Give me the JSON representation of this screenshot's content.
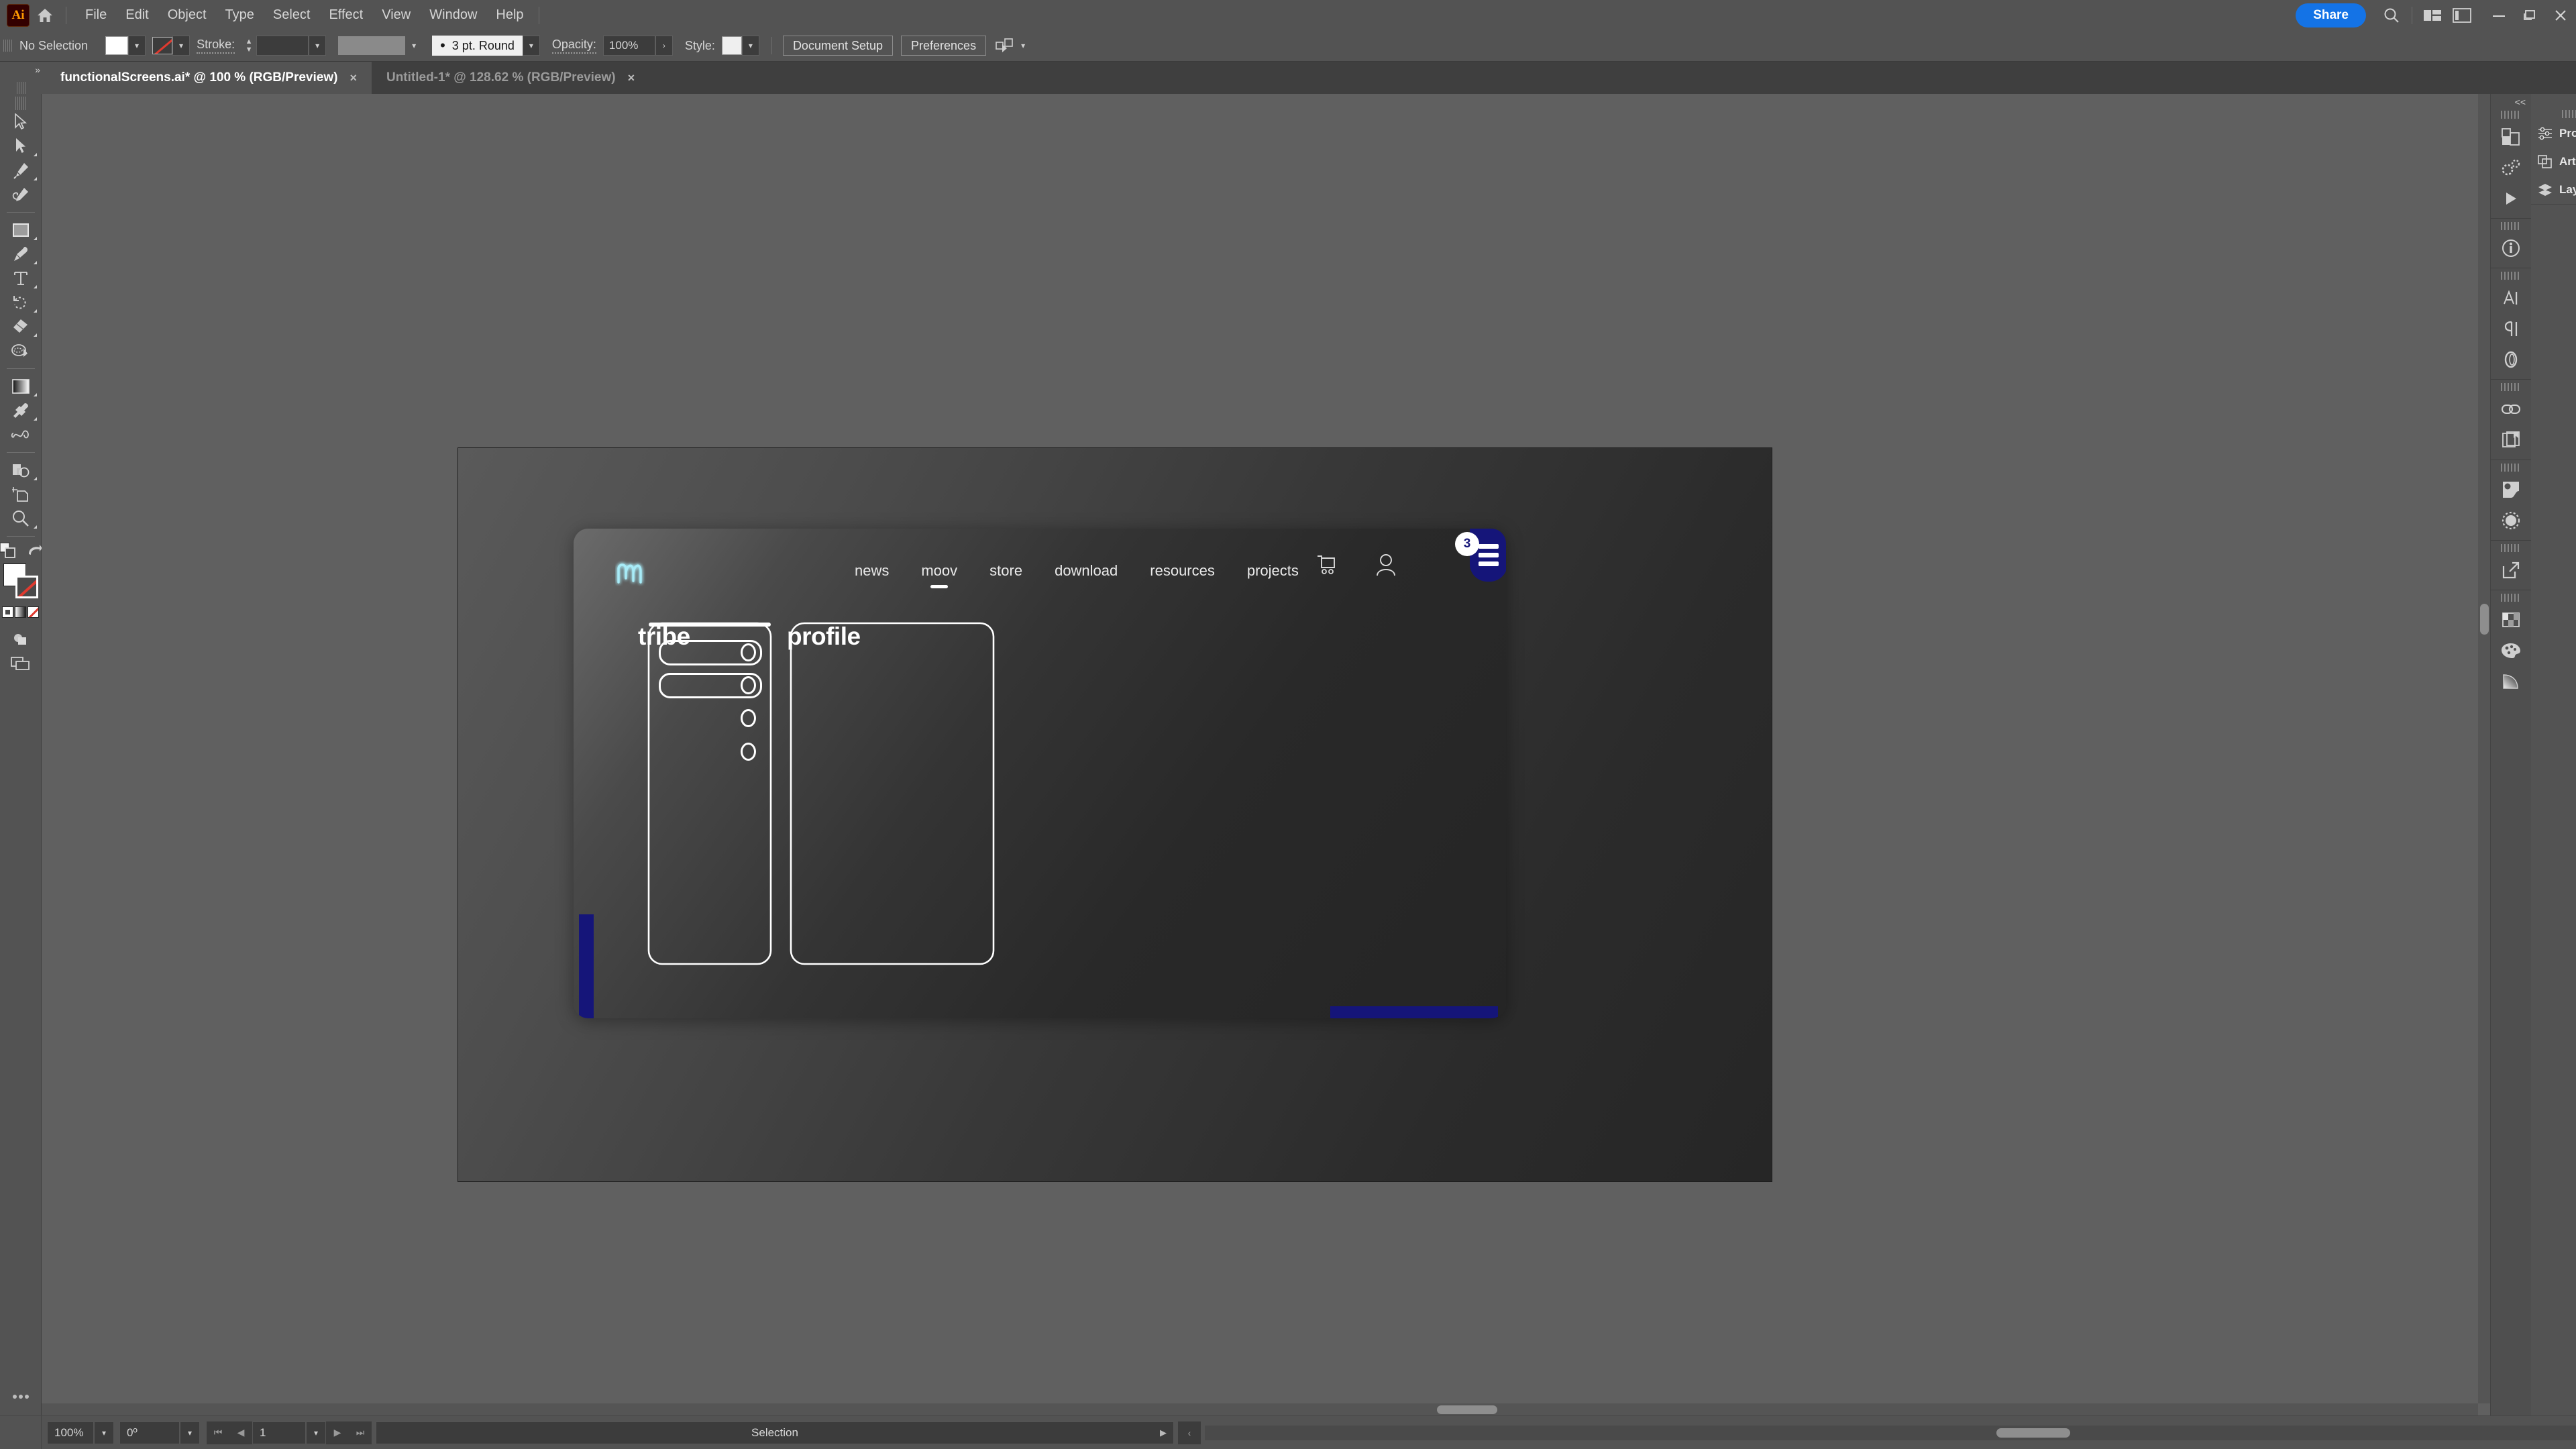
{
  "app": {
    "name": "Adobe Illustrator",
    "logo_text": "Ai"
  },
  "menubar": {
    "items": [
      "File",
      "Edit",
      "Object",
      "Type",
      "Select",
      "Effect",
      "View",
      "Window",
      "Help"
    ],
    "share_label": "Share",
    "icons": [
      "home-icon",
      "search-icon",
      "arrange-documents-icon",
      "workspace-switcher-icon"
    ],
    "window_controls": [
      "minimize",
      "maximize",
      "close"
    ]
  },
  "controlbar": {
    "selection_status": "No Selection",
    "fill_swatch": "white",
    "stroke_swatch": "none",
    "stroke_label": "Stroke:",
    "stroke_weight": "",
    "stroke_profile": "",
    "brush_definition": "3 pt. Round",
    "opacity_label": "Opacity:",
    "opacity_value": "100%",
    "style_label": "Style:",
    "document_setup_label": "Document Setup",
    "preferences_label": "Preferences",
    "select_similar_label": "select-similar-objects-icon"
  },
  "tabs": [
    {
      "title": "functionalScreens.ai* @ 100 % (RGB/Preview)",
      "active": true,
      "close": "×"
    },
    {
      "title": "Untitled-1* @ 128.62 % (RGB/Preview)",
      "active": false,
      "close": "×"
    }
  ],
  "toolbar": {
    "tools": [
      {
        "name": "selection-tool",
        "selected": false,
        "has_flyout": false
      },
      {
        "name": "direct-selection-tool",
        "selected": false,
        "has_flyout": true
      },
      {
        "name": "pen-tool",
        "selected": false,
        "has_flyout": true
      },
      {
        "name": "curvature-tool",
        "selected": false,
        "has_flyout": false
      },
      {
        "name": "rectangle-tool",
        "selected": false,
        "has_flyout": true
      },
      {
        "name": "paintbrush-tool",
        "selected": false,
        "has_flyout": true
      },
      {
        "name": "type-tool",
        "selected": false,
        "has_flyout": true
      },
      {
        "name": "rotate-tool",
        "selected": false,
        "has_flyout": true
      },
      {
        "name": "eraser-tool",
        "selected": false,
        "has_flyout": true
      },
      {
        "name": "scale-tool",
        "selected": false,
        "has_flyout": false
      },
      {
        "name": "gradient-tool",
        "selected": false,
        "has_flyout": true
      },
      {
        "name": "eyedropper-tool",
        "selected": false,
        "has_flyout": true
      },
      {
        "name": "blend-tool",
        "selected": false,
        "has_flyout": false
      },
      {
        "name": "shape-builder-tool",
        "selected": false,
        "has_flyout": true
      },
      {
        "name": "artboard-tool",
        "selected": false,
        "has_flyout": false
      },
      {
        "name": "zoom-tool",
        "selected": false,
        "has_flyout": true
      },
      {
        "name": "swap-fill-stroke-icon",
        "selected": false,
        "has_flyout": false
      },
      {
        "name": "draw-modes-icon",
        "selected": false,
        "has_flyout": false
      },
      {
        "name": "screen-mode-icon",
        "selected": false,
        "has_flyout": false
      },
      {
        "name": "edit-toolbar-icon",
        "selected": false,
        "has_flyout": false
      }
    ]
  },
  "right_panel": {
    "collapse_label": "<<",
    "tabs": [
      {
        "label": "Properties",
        "icon": "sliders-icon"
      },
      {
        "label": "Artboards",
        "icon": "artboards-icon"
      },
      {
        "label": "Layers",
        "icon": "layers-icon"
      }
    ],
    "rail_icons": [
      "libraries-icon",
      "cc-libraries-icon",
      "actions-icon",
      "info-icon",
      "character-icon",
      "paragraph-icon",
      "glyphs-icon",
      "links-icon",
      "document-info-icon",
      "image-trace-icon",
      "transparency-icon",
      "asset-export-icon",
      "swatches-icon",
      "color-icon",
      "gradient-icon"
    ]
  },
  "statusbar": {
    "zoom": "100%",
    "rotation": "0º",
    "artboard_number": "1",
    "status_text": "Selection",
    "nav_first": "⏮",
    "nav_prev": "◀",
    "nav_next": "▶",
    "nav_last": "⏭"
  },
  "design": {
    "site_nav": {
      "logo": "moov-logo-icon",
      "links": [
        {
          "label": "news",
          "active": false
        },
        {
          "label": "moov",
          "active": true
        },
        {
          "label": "store",
          "active": false
        },
        {
          "label": "download",
          "active": false
        },
        {
          "label": "resources",
          "active": false
        },
        {
          "label": "projects",
          "active": false
        }
      ],
      "cart_icon": "shopping-cart-icon",
      "account_icon": "user-account-icon",
      "menu_icon": "hamburger-menu-icon",
      "menu_badge": "3"
    },
    "panels": [
      {
        "title": "tribe"
      },
      {
        "title": "profile"
      }
    ],
    "colors": {
      "accent_blue": "#151579",
      "logo_cyan": "#9fe8f5",
      "outline_white": "#ffffff",
      "device_dark": "#262626"
    }
  }
}
